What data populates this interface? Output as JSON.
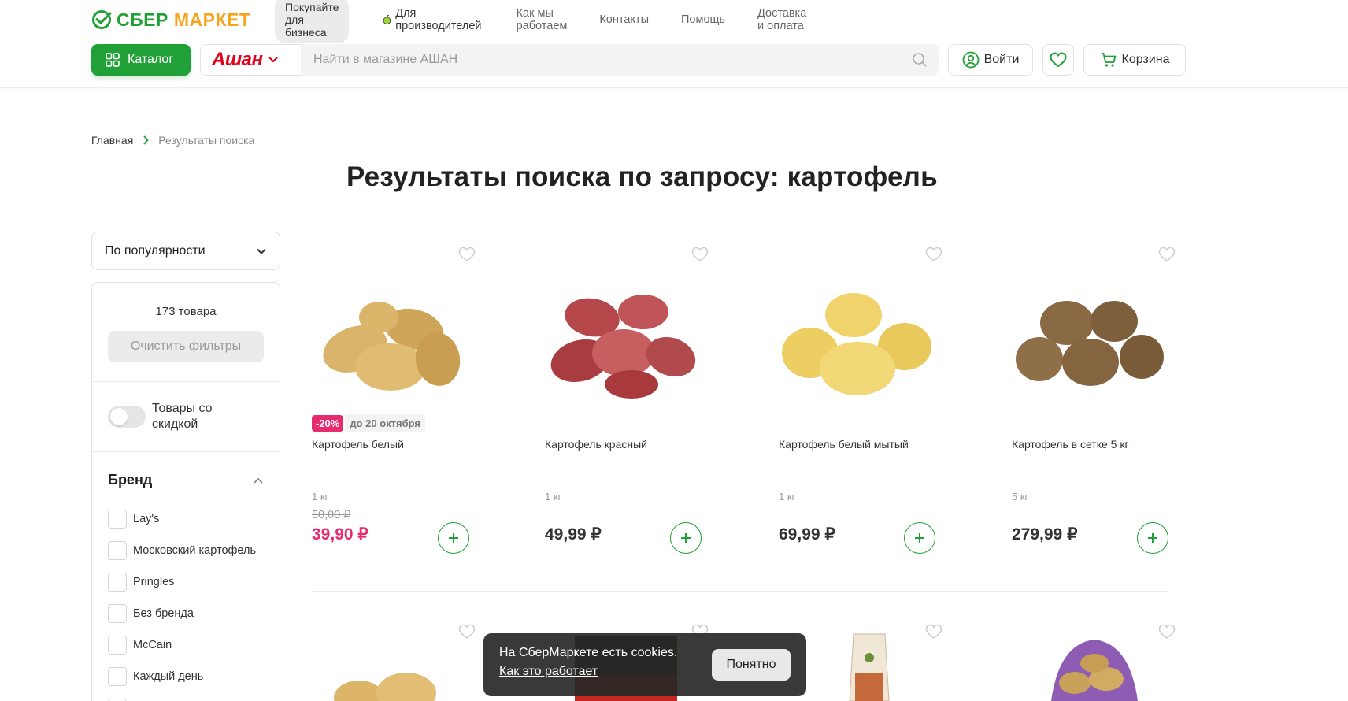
{
  "header": {
    "logo_sber": "СБЕР",
    "logo_market": "МАРКЕТ",
    "business_pill": "Покупайте для бизнеса",
    "links": [
      "Для производителей",
      "Как мы работаем",
      "Контакты",
      "Помощь",
      "Доставка и оплата"
    ],
    "catalog_label": "Каталог",
    "store_name": "Ашан",
    "search_placeholder": "Найти в магазине АШАН",
    "login_label": "Войти",
    "cart_label": "Корзина"
  },
  "breadcrumb": {
    "home": "Главная",
    "current": "Результаты поиска"
  },
  "page_title": "Результаты поиска по запросу: картофель",
  "sort": {
    "selected": "По популярности"
  },
  "filters": {
    "count": "173 товара",
    "clear_label": "Очистить фильтры",
    "discount_toggle_label": "Товары со скидкой",
    "brand_header": "Бренд",
    "brands": [
      "Lay's",
      "Московский картофель",
      "Pringles",
      "Без бренда",
      "McCain",
      "Каждый день"
    ]
  },
  "products": [
    {
      "name": "Картофель белый",
      "unit": "1 кг",
      "old_price": "50,00 ₽",
      "price": "39,90 ₽",
      "discount": "-20%",
      "promo_until": "до 20 октября"
    },
    {
      "name": "Картофель красный",
      "unit": "1 кг",
      "price": "49,99 ₽"
    },
    {
      "name": "Картофель белый мытый",
      "unit": "1 кг",
      "price": "69,99 ₽"
    },
    {
      "name": "Картофель в сетке 5 кг",
      "unit": "5 кг",
      "price": "279,99 ₽"
    }
  ],
  "cookie_banner": {
    "text": "На СберМаркете есть cookies.",
    "link": "Как это работает",
    "button": "Понятно"
  },
  "colors": {
    "brand_green": "#21a038",
    "sale_pink": "#e72b6f",
    "auchan_red": "#e2001a"
  }
}
